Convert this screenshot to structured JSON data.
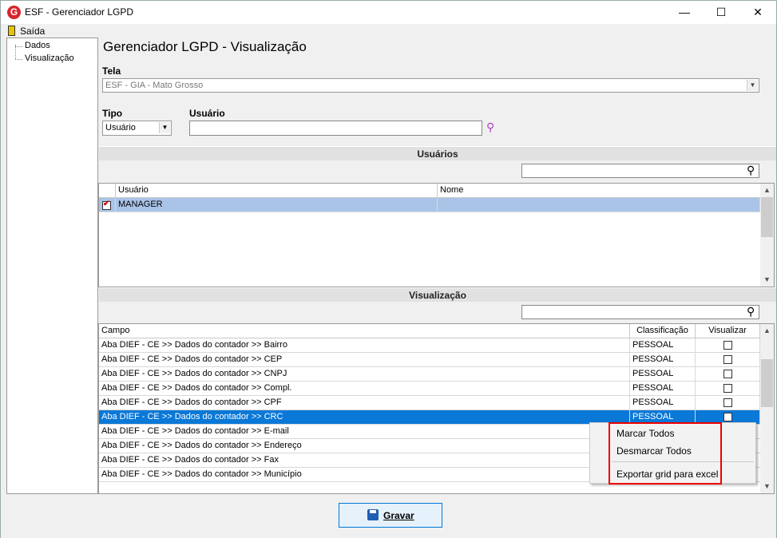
{
  "window": {
    "title": "ESF - Gerenciador LGPD",
    "logo": "G",
    "minimize": "—",
    "maximize": "☐",
    "close": "✕"
  },
  "menu": {
    "exit_label": "Saída"
  },
  "tree": {
    "items": [
      "Dados",
      "Visualização"
    ]
  },
  "page": {
    "title": "Gerenciador LGPD - Visualização"
  },
  "tela": {
    "label": "Tela",
    "value": "ESF - GIA - Mato Grosso"
  },
  "tipo": {
    "label": "Tipo",
    "value": "Usuário"
  },
  "usuario": {
    "label": "Usuário",
    "value": ""
  },
  "usuarios_section": {
    "title": "Usuários",
    "columns": [
      "Usuário",
      "Nome"
    ],
    "rows": [
      {
        "checked": true,
        "usuario": "MANAGER",
        "nome": ""
      }
    ]
  },
  "visualizacao_section": {
    "title": "Visualização",
    "columns": [
      "Campo",
      "Classificação",
      "Visualizar"
    ],
    "rows": [
      {
        "campo": "Aba DIEF - CE >> Dados do contador >> Bairro",
        "classificacao": "PESSOAL"
      },
      {
        "campo": "Aba DIEF - CE >> Dados do contador >> CEP",
        "classificacao": "PESSOAL"
      },
      {
        "campo": "Aba DIEF - CE >> Dados do contador >> CNPJ",
        "classificacao": "PESSOAL"
      },
      {
        "campo": "Aba DIEF - CE >> Dados do contador >> Compl.",
        "classificacao": "PESSOAL"
      },
      {
        "campo": "Aba DIEF - CE >> Dados do contador >> CPF",
        "classificacao": "PESSOAL"
      },
      {
        "campo": "Aba DIEF - CE >> Dados do contador >> CRC",
        "classificacao": "PESSOAL"
      },
      {
        "campo": "Aba DIEF - CE >> Dados do contador >> E-mail",
        "classificacao": ""
      },
      {
        "campo": "Aba DIEF - CE >> Dados do contador >> Endereço",
        "classificacao": ""
      },
      {
        "campo": "Aba DIEF - CE >> Dados do contador >> Fax",
        "classificacao": ""
      },
      {
        "campo": "Aba DIEF - CE >> Dados do contador >> Município",
        "classificacao": ""
      }
    ]
  },
  "context_menu": {
    "items": [
      "Marcar Todos",
      "Desmarcar Todos",
      "Exportar grid para excel"
    ]
  },
  "footer": {
    "save_label": "Gravar"
  },
  "colors": {
    "selection": "#0a78d7",
    "highlight_border": "#e00000",
    "accent": "#0078d7"
  }
}
